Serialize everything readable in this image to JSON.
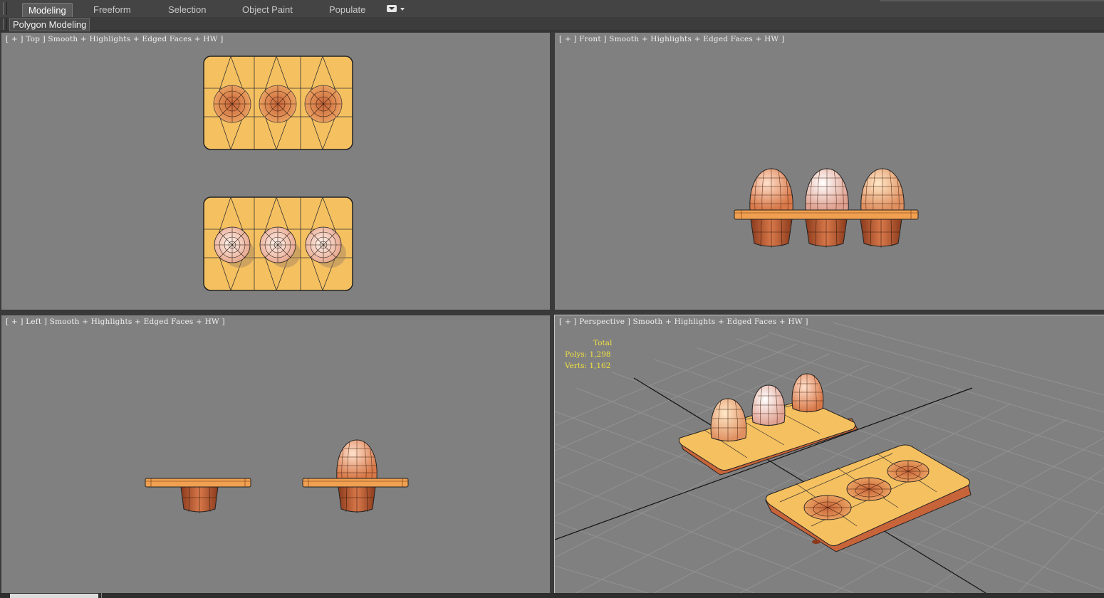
{
  "ribbon": {
    "tabs": [
      {
        "label": "Modeling"
      },
      {
        "label": "Freeform"
      },
      {
        "label": "Selection"
      },
      {
        "label": "Object Paint"
      },
      {
        "label": "Populate"
      }
    ],
    "active_tab": "Modeling"
  },
  "subbar": {
    "panel_label": "Polygon Modeling"
  },
  "viewports": {
    "top": {
      "label": "[ + ] Top ] Smooth + Highlights + Edged Faces + HW ]"
    },
    "front": {
      "label": "[ + ] Front ] Smooth + Highlights + Edged Faces + HW ]"
    },
    "left": {
      "label": "[ + ] Left ] Smooth + Highlights + Edged Faces + HW ]"
    },
    "perspective": {
      "label": "[ + ] Perspective ] Smooth + Highlights + Edged Faces + HW ]"
    }
  },
  "stats": {
    "total_label": "Total",
    "polys": "Polys: 1,298",
    "verts": "Verts: 1,162"
  },
  "colors": {
    "viewport_bg": "#808080",
    "tray_face": "#f5c060",
    "tray_side": "#c8643a",
    "egg": "#e89870",
    "stats_text": "#f0e040"
  }
}
